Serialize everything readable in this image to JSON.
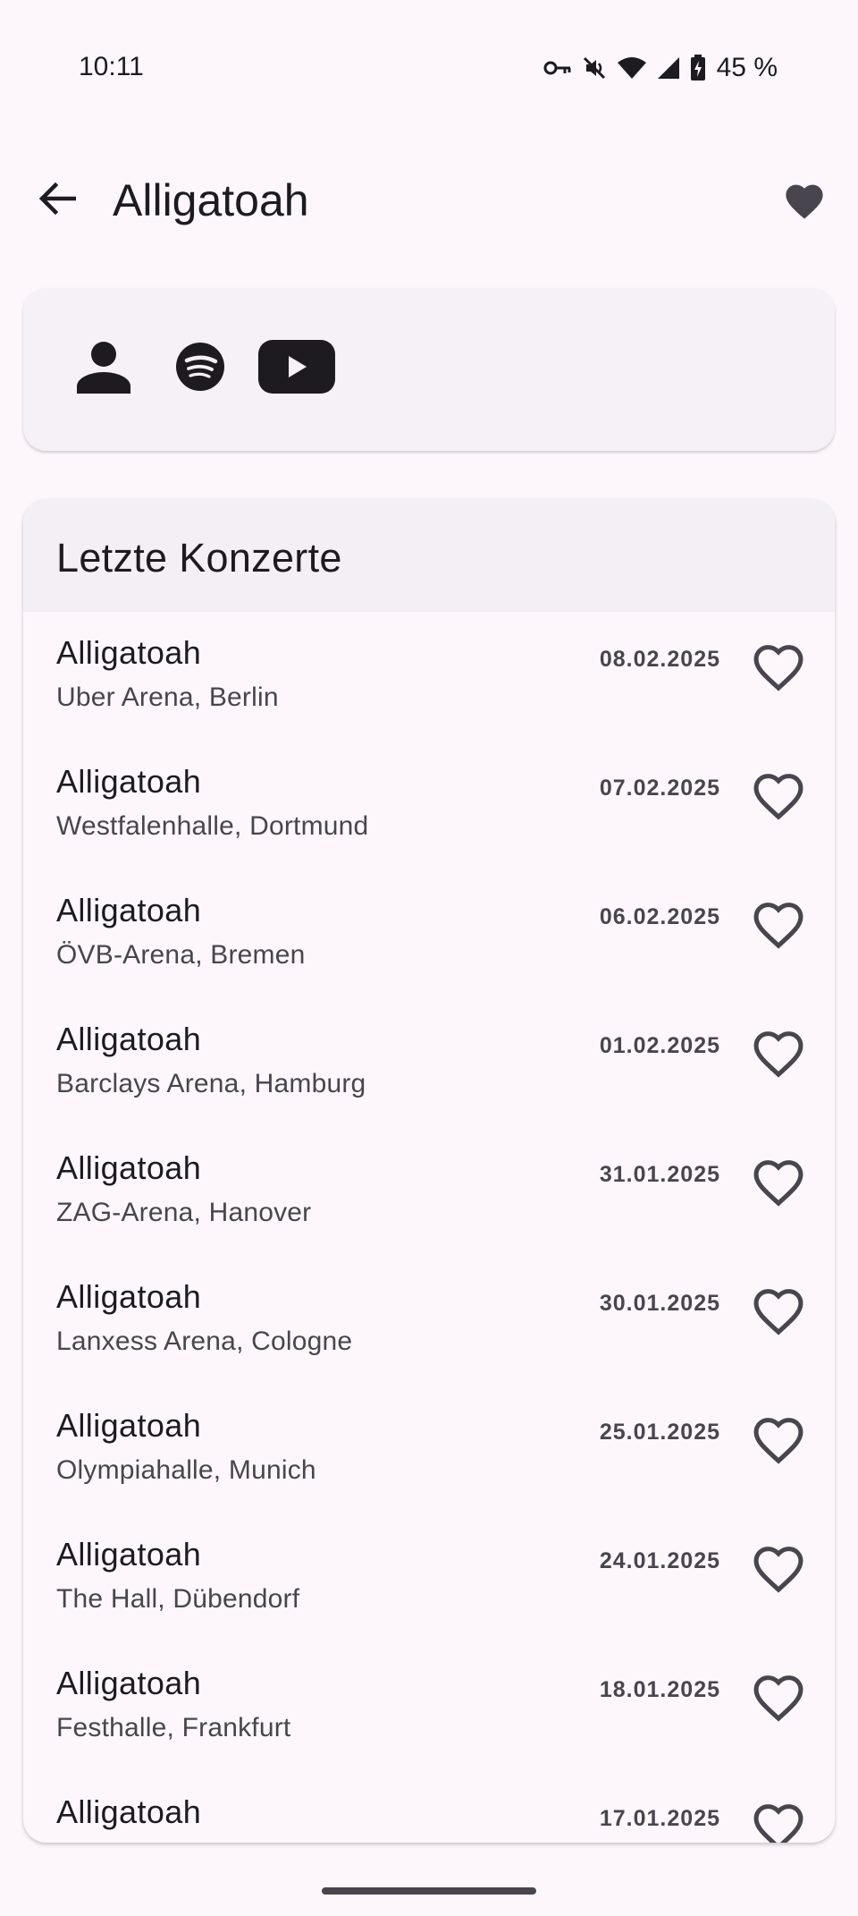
{
  "status_bar": {
    "time": "10:11",
    "battery": "45 %"
  },
  "app_bar": {
    "title": "Alligatoah",
    "back_icon": "arrow-back-icon",
    "favorite_icon": "heart-filled-icon"
  },
  "links": [
    {
      "name": "artist-profile",
      "icon": "person-icon"
    },
    {
      "name": "spotify",
      "icon": "spotify-icon"
    },
    {
      "name": "youtube",
      "icon": "youtube-icon"
    }
  ],
  "concerts": {
    "title": "Letzte Konzerte",
    "items": [
      {
        "artist": "Alligatoah",
        "venue": "Uber Arena, Berlin",
        "date": "08.02.2025"
      },
      {
        "artist": "Alligatoah",
        "venue": "Westfalenhalle, Dortmund",
        "date": "07.02.2025"
      },
      {
        "artist": "Alligatoah",
        "venue": "ÖVB-Arena, Bremen",
        "date": "06.02.2025"
      },
      {
        "artist": "Alligatoah",
        "venue": "Barclays Arena, Hamburg",
        "date": "01.02.2025"
      },
      {
        "artist": "Alligatoah",
        "venue": "ZAG-Arena, Hanover",
        "date": "31.01.2025"
      },
      {
        "artist": "Alligatoah",
        "venue": "Lanxess Arena, Cologne",
        "date": "30.01.2025"
      },
      {
        "artist": "Alligatoah",
        "venue": "Olympiahalle, Munich",
        "date": "25.01.2025"
      },
      {
        "artist": "Alligatoah",
        "venue": "The Hall, Dübendorf",
        "date": "24.01.2025"
      },
      {
        "artist": "Alligatoah",
        "venue": "Festhalle, Frankfurt",
        "date": "18.01.2025"
      },
      {
        "artist": "Alligatoah",
        "venue": "",
        "date": "17.01.2025"
      }
    ]
  },
  "colors": {
    "background": "#fdf7fb",
    "on_surface": "#1d1b20",
    "on_surface_variant": "#49454f",
    "icon_dark": "#1d1b20"
  }
}
